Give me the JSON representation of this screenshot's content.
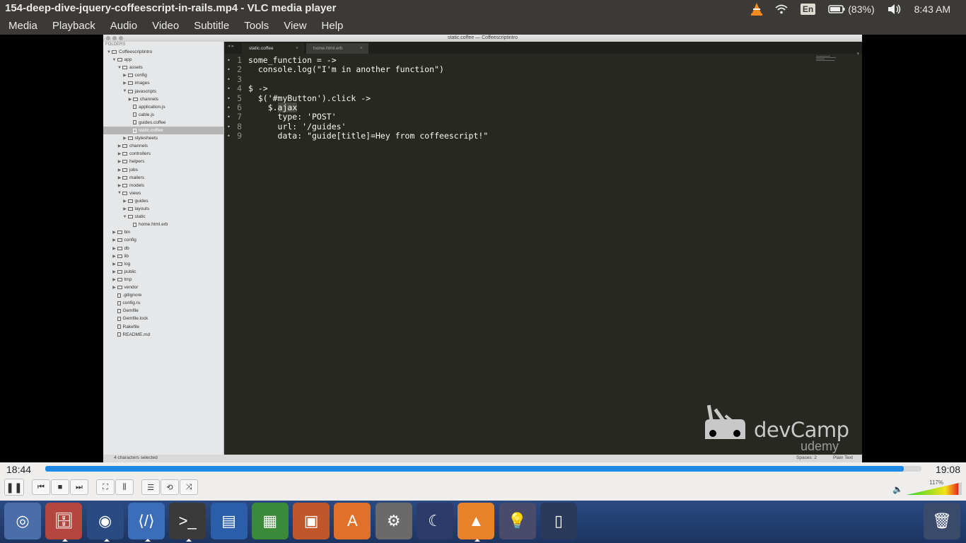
{
  "window": {
    "title": "154-deep-dive-jquery-coffeescript-in-rails.mp4 - VLC media player"
  },
  "indicators": {
    "language": "En",
    "battery": "(83%)",
    "clock": "8:43 AM"
  },
  "menu": [
    "Media",
    "Playback",
    "Audio",
    "Video",
    "Subtitle",
    "Tools",
    "View",
    "Help"
  ],
  "editor": {
    "window_title": "static.coffee — Coffeescriptintro",
    "folders_header": "FOLDERS",
    "tabs": [
      {
        "label": "static.coffee",
        "active": true
      },
      {
        "label": "home.html.erb",
        "active": false
      }
    ],
    "tree": [
      {
        "label": "Coffeescriptintro",
        "depth": 0,
        "type": "folder-open"
      },
      {
        "label": "app",
        "depth": 1,
        "type": "folder-open"
      },
      {
        "label": "assets",
        "depth": 2,
        "type": "folder-open"
      },
      {
        "label": "config",
        "depth": 3,
        "type": "folder"
      },
      {
        "label": "images",
        "depth": 3,
        "type": "folder"
      },
      {
        "label": "javascripts",
        "depth": 3,
        "type": "folder-open"
      },
      {
        "label": "channels",
        "depth": 4,
        "type": "folder"
      },
      {
        "label": "application.js",
        "depth": 4,
        "type": "file"
      },
      {
        "label": "cable.js",
        "depth": 4,
        "type": "file"
      },
      {
        "label": "guides.coffee",
        "depth": 4,
        "type": "file"
      },
      {
        "label": "static.coffee",
        "depth": 4,
        "type": "file",
        "selected": true
      },
      {
        "label": "stylesheets",
        "depth": 3,
        "type": "folder"
      },
      {
        "label": "channels",
        "depth": 2,
        "type": "folder"
      },
      {
        "label": "controllers",
        "depth": 2,
        "type": "folder"
      },
      {
        "label": "helpers",
        "depth": 2,
        "type": "folder"
      },
      {
        "label": "jobs",
        "depth": 2,
        "type": "folder"
      },
      {
        "label": "mailers",
        "depth": 2,
        "type": "folder"
      },
      {
        "label": "models",
        "depth": 2,
        "type": "folder"
      },
      {
        "label": "views",
        "depth": 2,
        "type": "folder-open"
      },
      {
        "label": "guides",
        "depth": 3,
        "type": "folder"
      },
      {
        "label": "layouts",
        "depth": 3,
        "type": "folder"
      },
      {
        "label": "static",
        "depth": 3,
        "type": "folder-open"
      },
      {
        "label": "home.html.erb",
        "depth": 4,
        "type": "file"
      },
      {
        "label": "bin",
        "depth": 1,
        "type": "folder"
      },
      {
        "label": "config",
        "depth": 1,
        "type": "folder"
      },
      {
        "label": "db",
        "depth": 1,
        "type": "folder"
      },
      {
        "label": "lib",
        "depth": 1,
        "type": "folder"
      },
      {
        "label": "log",
        "depth": 1,
        "type": "folder"
      },
      {
        "label": "public",
        "depth": 1,
        "type": "folder"
      },
      {
        "label": "tmp",
        "depth": 1,
        "type": "folder"
      },
      {
        "label": "vendor",
        "depth": 1,
        "type": "folder"
      },
      {
        "label": ".gitignore",
        "depth": 1,
        "type": "file"
      },
      {
        "label": "config.ru",
        "depth": 1,
        "type": "file"
      },
      {
        "label": "Gemfile",
        "depth": 1,
        "type": "file"
      },
      {
        "label": "Gemfile.lock",
        "depth": 1,
        "type": "file"
      },
      {
        "label": "Rakefile",
        "depth": 1,
        "type": "file"
      },
      {
        "label": "README.md",
        "depth": 1,
        "type": "file"
      }
    ],
    "code_lines": [
      {
        "n": "1",
        "text": "some_function = ->"
      },
      {
        "n": "2",
        "text": "  console.log(\"I'm in another function\")"
      },
      {
        "n": "3",
        "text": ""
      },
      {
        "n": "4",
        "text": "$ ->"
      },
      {
        "n": "5",
        "text": "  $('#myButton').click ->"
      },
      {
        "n": "6",
        "text": "    $.ajax"
      },
      {
        "n": "7",
        "text": "      type: 'POST'"
      },
      {
        "n": "8",
        "text": "      url: '/guides'"
      },
      {
        "n": "9",
        "text": "      data: \"guide[title]=Hey from coffeescript!\""
      }
    ],
    "status_left": "4 characters selected",
    "status_spaces": "Spaces: 2",
    "status_syntax": "Plain Text"
  },
  "watermark": {
    "brand": "devCamp",
    "platform": "udemy"
  },
  "player": {
    "elapsed": "18:44",
    "total": "19:08",
    "progress_fraction": 0.98,
    "volume_label": "117%",
    "volume_fraction": 0.94,
    "buttons": [
      "pause-icon",
      "previous-icon",
      "stop-icon",
      "next-icon",
      "fullscreen-icon",
      "extended-settings-icon",
      "playlist-icon",
      "loop-icon",
      "shuffle-icon"
    ]
  },
  "launcher": {
    "apps": [
      "ubuntu-dash-icon",
      "files-icon",
      "chrome-icon",
      "vscode-icon",
      "terminal-icon",
      "writer-icon",
      "calc-icon",
      "impress-icon",
      "software-center-icon",
      "system-settings-icon",
      "eclipse-icon",
      "vlc-icon",
      "idea-icon",
      "phone-icon",
      "trash-icon"
    ],
    "colors": {
      "bar": "#1d3461",
      "accent": "#1e88e5"
    }
  }
}
